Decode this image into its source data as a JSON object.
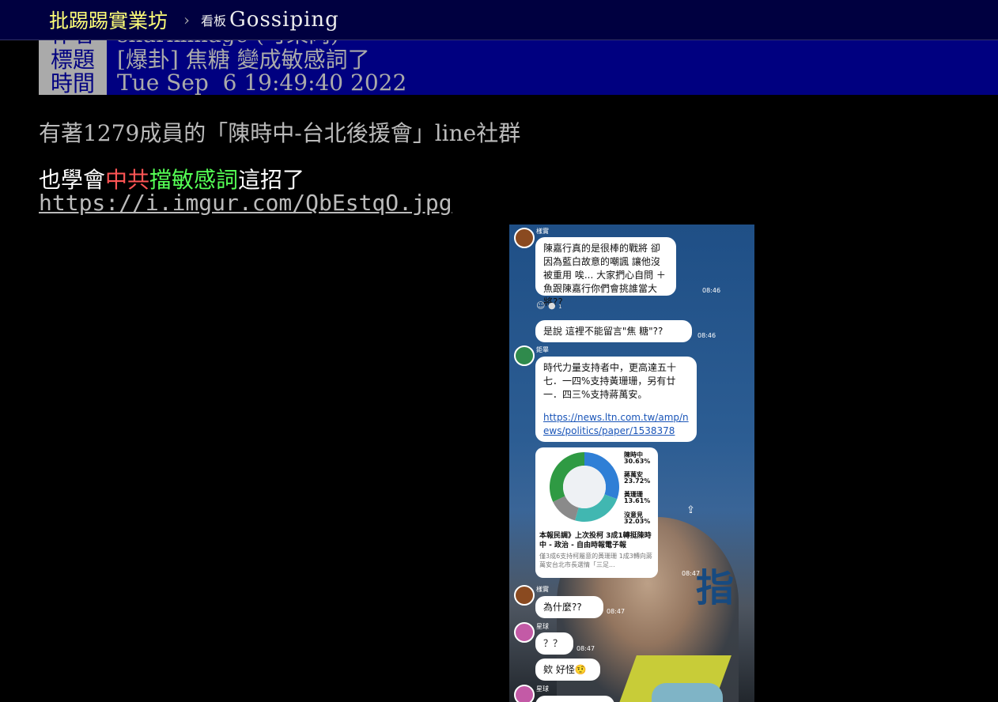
{
  "nav": {
    "site_name": "批踢踢實業坊",
    "separator": "›",
    "board_label": "看板",
    "board_name": "Gossiping"
  },
  "article": {
    "author_tag": "作者",
    "author_value": "sharkimage (可樂肉)",
    "title_tag": "標題",
    "title_value": "[爆卦] 焦糖 變成敏感詞了",
    "time_tag": "時間",
    "time_value": "Tue Sep  6 19:49:40 2022"
  },
  "content": {
    "line1": "有著1279成員的「陳時中-台北後援會」line社群",
    "line2_part1": "也學會",
    "line2_red": "中共",
    "line2_green": "擋敏感詞",
    "line2_part2": "這招了",
    "link": "https://i.imgur.com/QbEstqO.jpg"
  },
  "embed": {
    "sender1": "樣實",
    "msg1": "陳嘉行真的是很棒的戰將  卻因為藍白故意的嘲諷  讓他沒被重用  唉... 大家捫心自問  ＋魚跟陳嘉行你們會挑誰當大將??",
    "time1": "08:46",
    "reaction_count": "1",
    "msg2": "是說  這裡不能留言\"焦  糖\"??",
    "time2": "08:46",
    "sender2": "鉅畢",
    "msg3": "時代力量支持者中，更高達五十七．一四%支持黃珊珊，另有廿一．四三%支持蔣萬安。",
    "msg3_link": "https://news.ltn.com.tw/amp/news/politics/paper/1538378",
    "poll": [
      {
        "name": "陳時中",
        "pct": 30.63,
        "color": "#2f7fd6"
      },
      {
        "name": "蔣萬安",
        "pct": 23.72,
        "color": "#41b7b1"
      },
      {
        "name": "黃珊珊",
        "pct": 13.61,
        "color": "#8a8a8a"
      },
      {
        "name": "沒意見",
        "pct": 32.03,
        "color": "#2f9a43"
      }
    ],
    "poll_labels": [
      "陳時中",
      "30.63%",
      "蔣萬安",
      "23.72%",
      "黃珊珊",
      "13.61%",
      "沒意見",
      "32.03%"
    ],
    "news_title": "本報民調》上次投柯 3成1轉挺陳時中 - 政治 - 自由時報電子報",
    "news_desc": "僅3成6支持柯屬意的黃珊珊 1成3轉向蔣萬安台北市長選情「三足...",
    "time3": "08:47",
    "sender3": "樣實",
    "msg4": "為什麼??",
    "time4": "08:47",
    "sender4": "星球",
    "msg5": "？？",
    "time5": "08:47",
    "msg6": "欸 好怪🤨",
    "sender5": "星球",
    "bg_text": "指"
  }
}
